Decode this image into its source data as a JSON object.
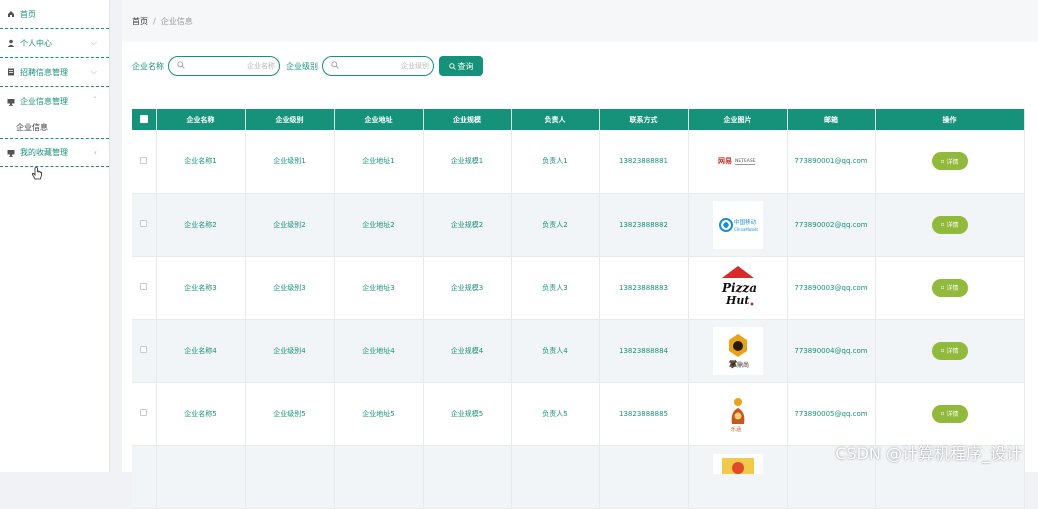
{
  "sidebar": {
    "items": [
      {
        "label": "首页",
        "icon": "home-icon"
      },
      {
        "label": "个人中心",
        "icon": "user-icon"
      },
      {
        "label": "招聘信息管理",
        "icon": "doc-icon"
      },
      {
        "label": "企业信息管理",
        "icon": "monitor-icon"
      },
      {
        "label": "我的收藏管理",
        "icon": "monitor-icon"
      }
    ],
    "sub_item": "企业信息"
  },
  "breadcrumb": {
    "home": "首页",
    "sep": "/",
    "current": "企业信息"
  },
  "search": {
    "name_label": "企业名称",
    "name_placeholder": "企业名称",
    "level_label": "企业级别",
    "level_placeholder": "企业级别",
    "button": "查询"
  },
  "table": {
    "headers": [
      "企业名称",
      "企业级别",
      "企业地址",
      "企业规模",
      "负责人",
      "联系方式",
      "企业图片",
      "邮箱",
      "操作"
    ],
    "rows": [
      {
        "name": "企业名称1",
        "level": "企业级别1",
        "addr": "企业地址1",
        "scale": "企业规模1",
        "owner": "负责人1",
        "phone": "13823888881",
        "email": "773890001@qq.com",
        "action": "详情"
      },
      {
        "name": "企业名称2",
        "level": "企业级别2",
        "addr": "企业地址2",
        "scale": "企业规模2",
        "owner": "负责人2",
        "phone": "13823888882",
        "email": "773890002@qq.com",
        "action": "详情"
      },
      {
        "name": "企业名称3",
        "level": "企业级别3",
        "addr": "企业地址3",
        "scale": "企业规模3",
        "owner": "负责人3",
        "phone": "13823888883",
        "email": "773890003@qq.com",
        "action": "详情"
      },
      {
        "name": "企业名称4",
        "level": "企业级别4",
        "addr": "企业地址4",
        "scale": "企业规模4",
        "owner": "负责人4",
        "phone": "13823888884",
        "email": "773890004@qq.com",
        "action": "详情"
      },
      {
        "name": "企业名称5",
        "level": "企业级别5",
        "addr": "企业地址5",
        "scale": "企业规模5",
        "owner": "负责人5",
        "phone": "13823888885",
        "email": "773890005@qq.com",
        "action": "详情"
      }
    ]
  },
  "watermark": "CSDN @计算机程序_设计",
  "colors": {
    "primary": "#17927a",
    "detail_button": "#91b93b"
  }
}
